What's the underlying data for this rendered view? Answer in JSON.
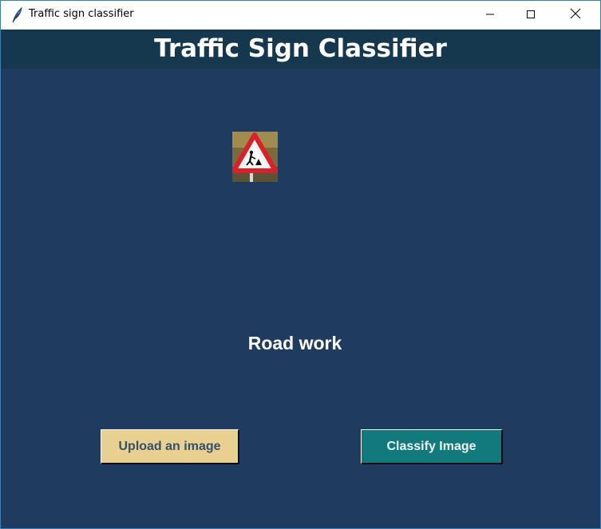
{
  "window": {
    "title": "Traffic sign classifier",
    "icon": "feather-icon",
    "controls": [
      "minimize-icon",
      "maximize-icon",
      "close-icon"
    ]
  },
  "header": {
    "title": "Traffic Sign Classifier"
  },
  "image": {
    "icon": "road-work-sign-thumbnail"
  },
  "result": {
    "label": "Road work"
  },
  "buttons": {
    "upload_label": "Upload an image",
    "classify_label": "Classify Image"
  },
  "colors": {
    "background": "#1f3c60",
    "header": "#15384f",
    "upload_button": "#e8d090",
    "classify_button": "#127a7c",
    "text": "#ffffff"
  }
}
